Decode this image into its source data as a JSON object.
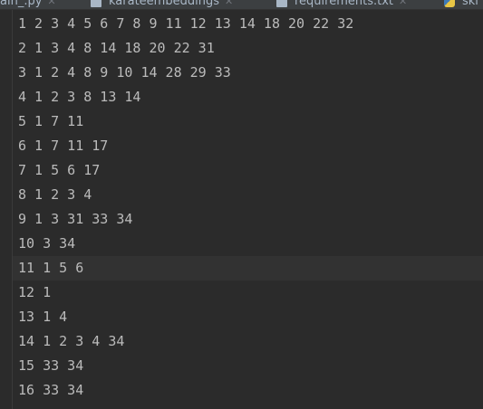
{
  "tabs": [
    {
      "label": "ain_.py",
      "icon": "python-file-icon"
    },
    {
      "label": "karateembeddings",
      "icon": "text-file-icon"
    },
    {
      "label": "requirements.txt",
      "icon": "text-file-icon"
    },
    {
      "label": "ski",
      "icon": "python-file-icon"
    }
  ],
  "editor": {
    "current_line_index": 10,
    "lines": [
      "1 2 3 4 5 6 7 8 9 11 12 13 14 18 20 22 32",
      "2 1 3 4 8 14 18 20 22 31",
      "3 1 2 4 8 9 10 14 28 29 33",
      "4 1 2 3 8 13 14",
      "5 1 7 11",
      "6 1 7 11 17",
      "7 1 5 6 17",
      "8 1 2 3 4",
      "9 1 3 31 33 34",
      "10 3 34",
      "11 1 5 6",
      "12 1",
      "13 1 4",
      "14 1 2 3 4 34",
      "15 33 34",
      "16 33 34"
    ]
  }
}
